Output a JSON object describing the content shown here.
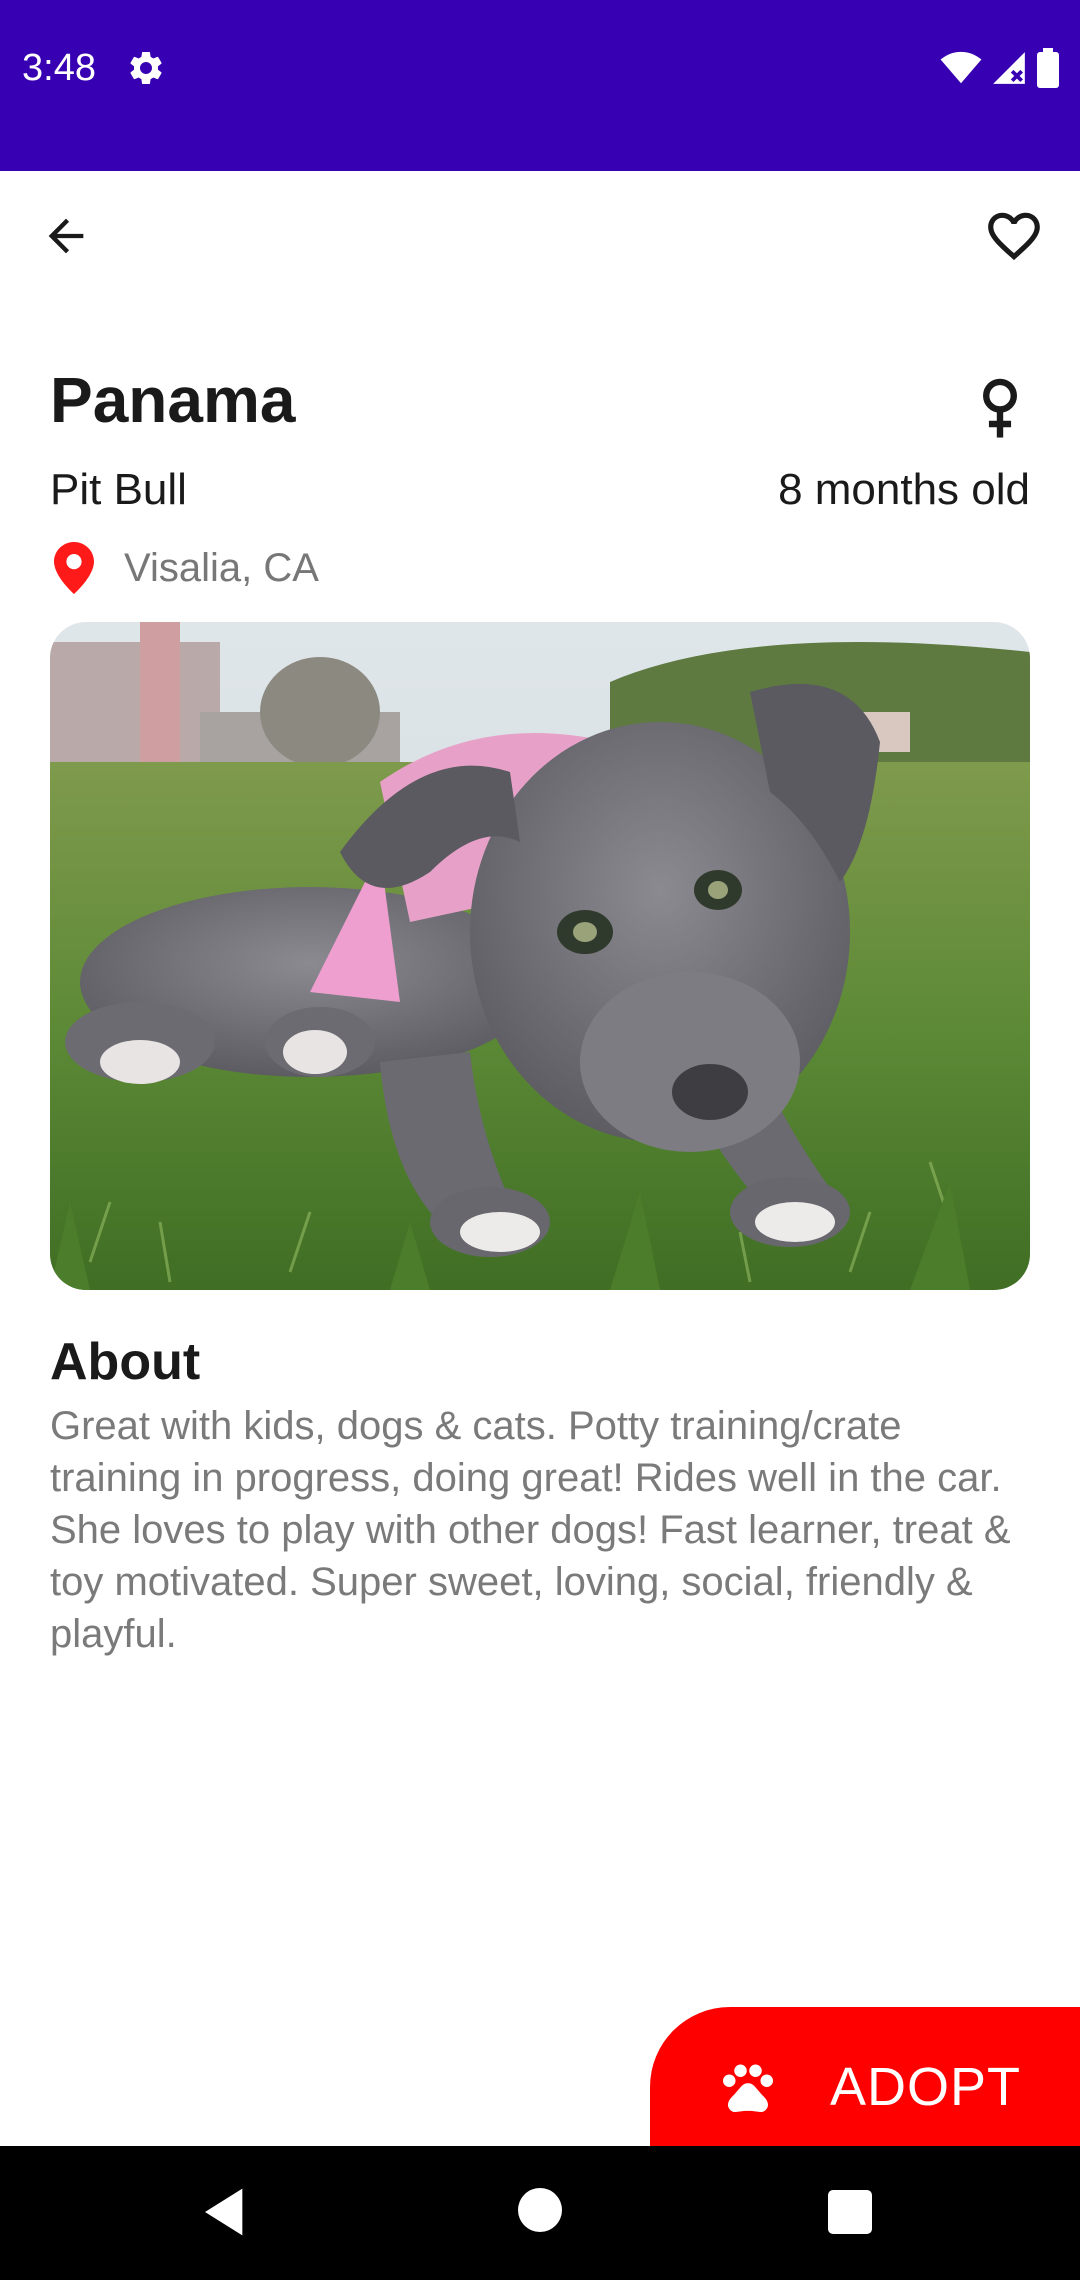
{
  "status_bar": {
    "time": "3:48",
    "icons": [
      "settings-icon",
      "wifi-icon",
      "signal-icon",
      "battery-icon"
    ],
    "background": "#3700B3"
  },
  "top_bar": {
    "back_icon": "arrow-back-icon",
    "favorite_icon": "heart-outline-icon"
  },
  "pet": {
    "name": "Panama",
    "gender_icon": "female-icon",
    "breed": "Pit Bull",
    "age": "8 months old",
    "location": "Visalia, CA",
    "location_icon": "map-pin-icon",
    "photo_icon": "dog-photo"
  },
  "about": {
    "title": "About",
    "text": "Great with kids, dogs & cats. Potty training/crate training in progress, doing great! Rides well in the car. She loves to play with other dogs! Fast learner, treat & toy motivated. Super sweet, loving, social, friendly & playful."
  },
  "adopt_button": {
    "label": "ADOPT",
    "icon": "paw-icon",
    "color": "#ff0000"
  },
  "nav_bar": {
    "icons": [
      "nav-back-icon",
      "nav-home-icon",
      "nav-recents-icon"
    ]
  },
  "colors": {
    "accent": "#3700B3",
    "location_pin": "#ff1a1a",
    "body_text": "#7a7a7a"
  }
}
